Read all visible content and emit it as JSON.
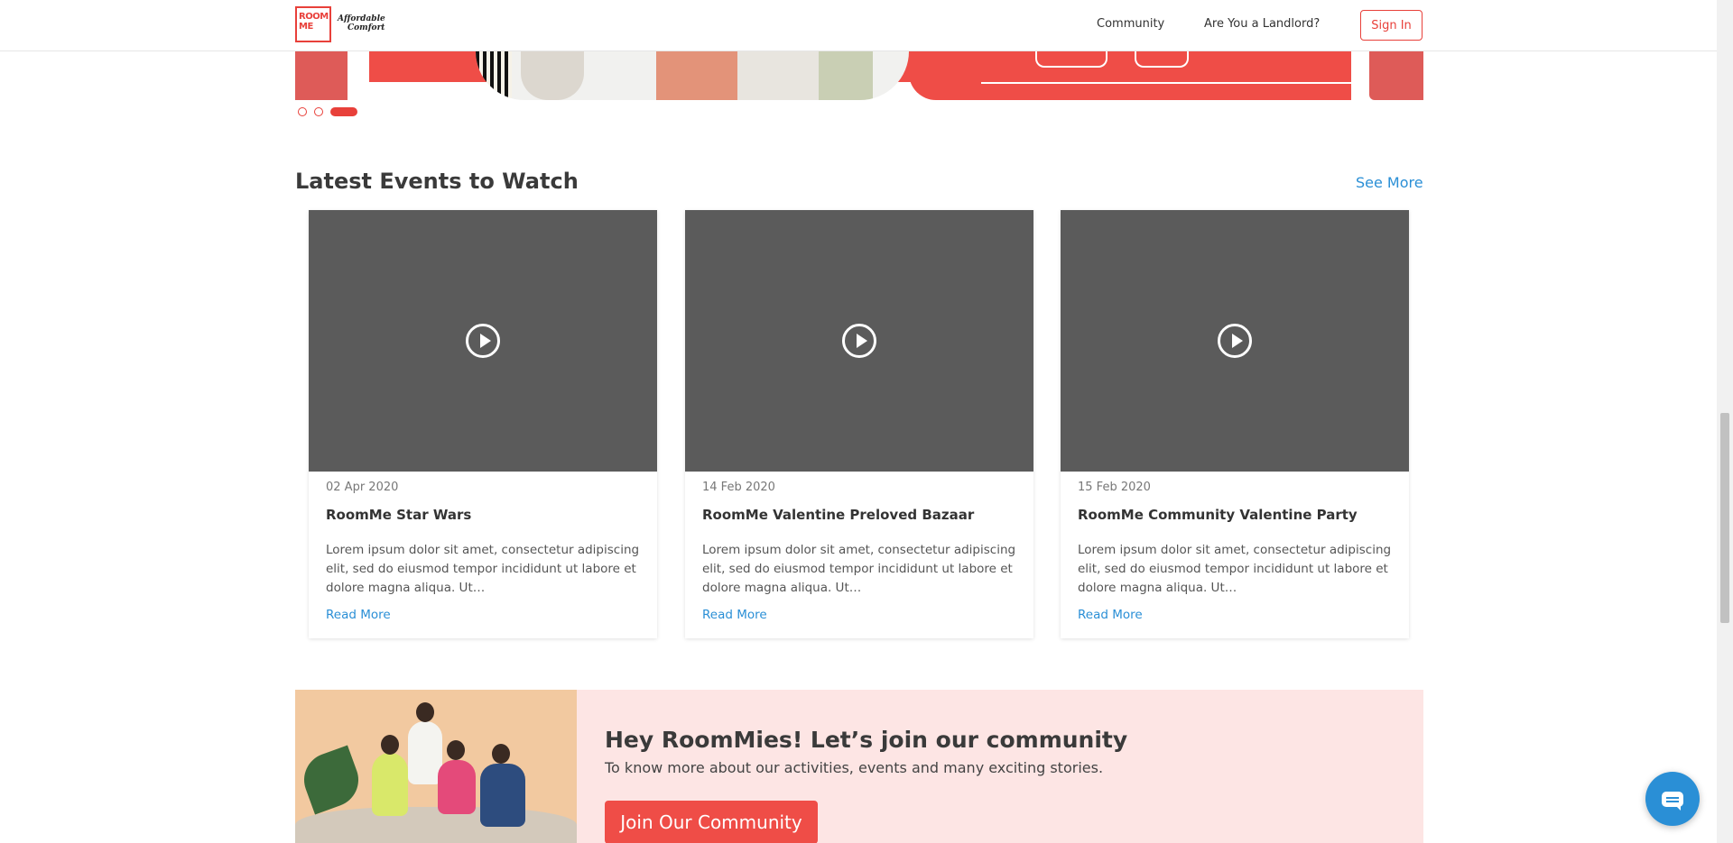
{
  "nav": {
    "logo_text": "ROOM ME",
    "tagline_line1": "Affordable",
    "tagline_line2": "Comfort",
    "links": [
      {
        "label": "Community"
      },
      {
        "label": "Are You a Landlord?"
      }
    ],
    "signin_label": "Sign In"
  },
  "carousel": {
    "slide_count": 3,
    "active_index": 2
  },
  "events": {
    "title": "Latest Events to Watch",
    "see_more": "See More",
    "cards": [
      {
        "date": "02 Apr 2020",
        "title": "RoomMe Star Wars",
        "description": "Lorem ipsum dolor sit amet, consectetur adipiscing elit, sed do eiusmod tempor incididunt ut labore et dolore magna aliqua. Ut…",
        "read_more": "Read More"
      },
      {
        "date": "14 Feb 2020",
        "title": "RoomMe Valentine Preloved Bazaar",
        "description": "Lorem ipsum dolor sit amet, consectetur adipiscing elit, sed do eiusmod tempor incididunt ut labore et dolore magna aliqua. Ut…",
        "read_more": "Read More"
      },
      {
        "date": "15 Feb 2020",
        "title": "RoomMe Community Valentine Party",
        "description": "Lorem ipsum dolor sit amet, consectetur adipiscing elit, sed do eiusmod tempor incididunt ut labore et dolore magna aliqua. Ut…",
        "read_more": "Read More"
      }
    ]
  },
  "community": {
    "heading": "Hey RoomMies! Let’s join our community",
    "subtitle": "To know more about our activities, events and many exciting stories.",
    "button": "Join Our Community"
  },
  "colors": {
    "brand_red": "#e8403a",
    "link_blue": "#2a8fd6",
    "video_placeholder": "#5b5b5b",
    "community_bg": "#fde5e4"
  },
  "icons": {
    "play": "play-circle-icon",
    "chat": "chat-icon"
  }
}
